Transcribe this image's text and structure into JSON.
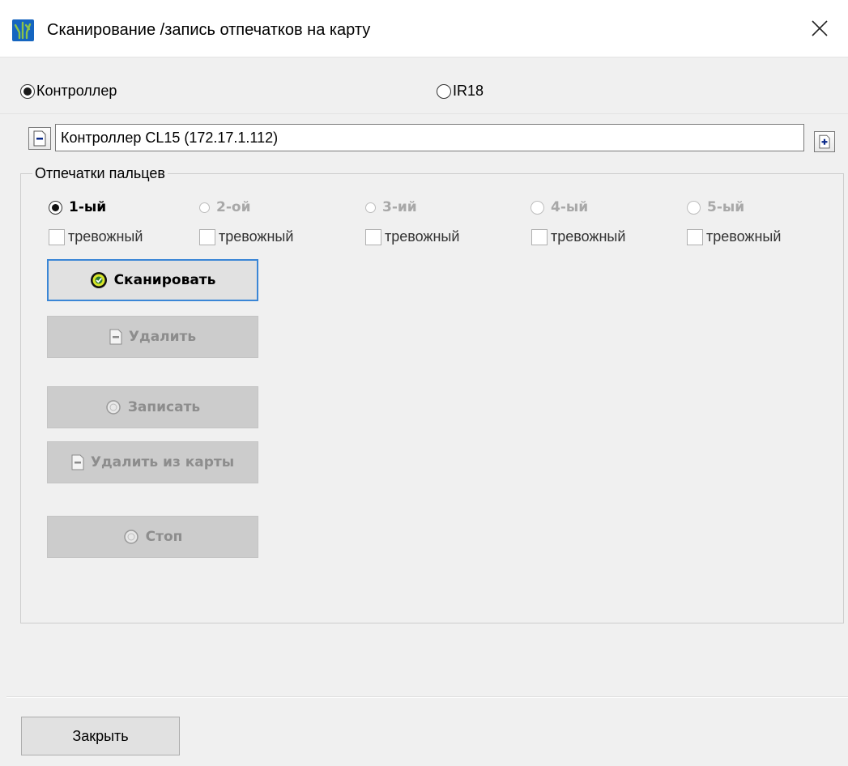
{
  "window": {
    "title": "Сканирование /запись отпечатков на карту",
    "close_label": "×"
  },
  "source": {
    "options": [
      {
        "label": "Контроллер",
        "selected": true
      },
      {
        "label": "IR18",
        "selected": false
      }
    ]
  },
  "device": {
    "value": "Контроллер CL15 (172.17.1.112)"
  },
  "fingerprints": {
    "legend": "Отпечатки пальцев",
    "fingers": [
      {
        "label": "1-ый",
        "selected": true,
        "enabled": true
      },
      {
        "label": "2-ой",
        "selected": false,
        "enabled": false
      },
      {
        "label": "3-ий",
        "selected": false,
        "enabled": false
      },
      {
        "label": "4-ый",
        "selected": false,
        "enabled": false
      },
      {
        "label": "5-ый",
        "selected": false,
        "enabled": false
      }
    ],
    "alarm_label": "тревожный"
  },
  "actions": {
    "scan": "Сканировать",
    "delete": "Удалить",
    "write": "Записать",
    "delete_from_card": "Удалить из карты",
    "stop": "Стоп"
  },
  "footer": {
    "close": "Закрыть"
  },
  "colors": {
    "focus_border": "#3a86d6",
    "disabled_text": "#8d8d8d",
    "app_icon": "#1565c0"
  }
}
